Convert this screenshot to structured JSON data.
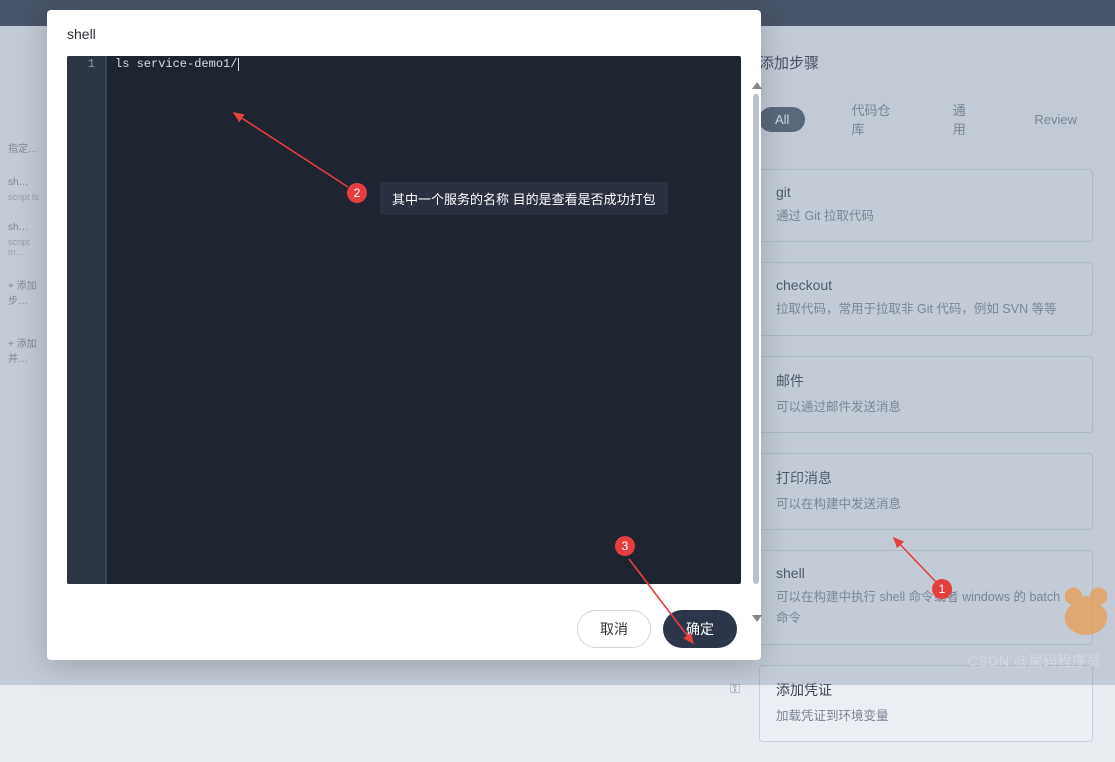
{
  "topbar": {},
  "left": {
    "item1": "指定…",
    "item2": "sh…",
    "sub2": "script  ls",
    "item3": "sh…",
    "sub3": "script  m…",
    "add_step": "+ 添加步…",
    "add_stage": "+ 添加并…"
  },
  "rpanel": {
    "title": "添加步骤",
    "tabs": {
      "all": "All",
      "repo": "代码仓库",
      "general": "通用",
      "review": "Review"
    },
    "steps": [
      {
        "title": "git",
        "desc": "通过 Git 拉取代码"
      },
      {
        "title": "checkout",
        "desc": "拉取代码，常用于拉取非 Git 代码，例如 SVN 等等"
      },
      {
        "title": "邮件",
        "desc": "可以通过邮件发送消息"
      },
      {
        "title": "打印消息",
        "desc": "可以在构建中发送消息"
      },
      {
        "title": "shell",
        "desc": "可以在构建中执行 shell 命令或者 windows 的 batch 命令"
      },
      {
        "title": "添加凭证",
        "desc": "加载凭证到环境变量"
      }
    ]
  },
  "modal": {
    "title": "shell",
    "line_no": "1",
    "code": "ls service-demo1/",
    "cancel": "取消",
    "ok": "确定"
  },
  "anno": {
    "badge1": "1",
    "badge2": "2",
    "badge3": "3",
    "tip2": "其中一个服务的名称 目的是查看是否成功打包"
  },
  "wm": "CSDN @屎码程序员"
}
